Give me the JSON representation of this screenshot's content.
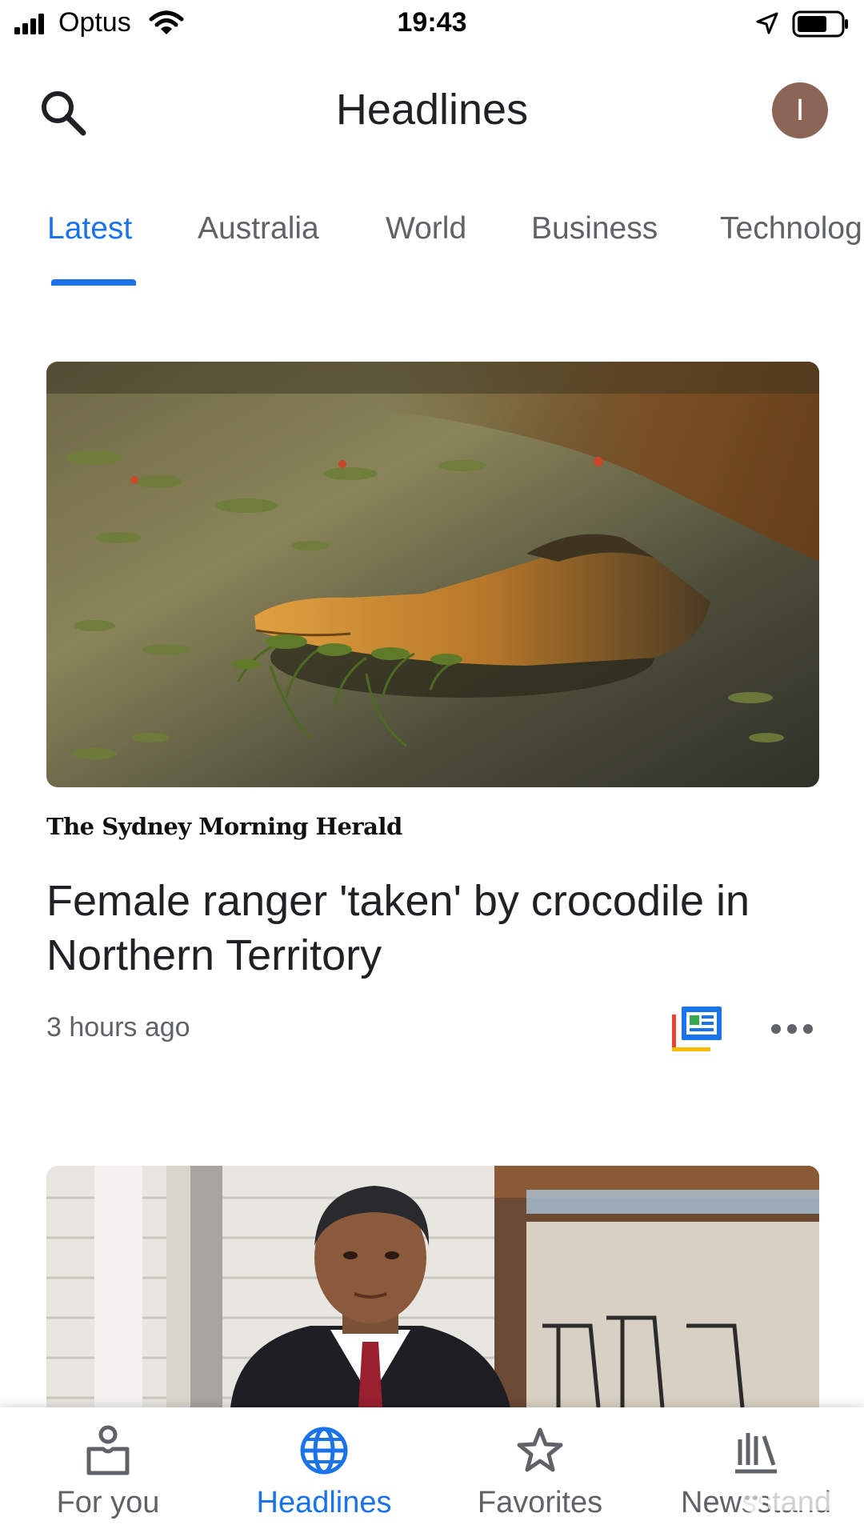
{
  "status_bar": {
    "carrier": "Optus",
    "time": "19:43"
  },
  "app_bar": {
    "title": "Headlines",
    "avatar_initial": "I"
  },
  "tabs": [
    {
      "label": "Latest",
      "active": true
    },
    {
      "label": "Australia"
    },
    {
      "label": "World"
    },
    {
      "label": "Business"
    },
    {
      "label": "Technolog"
    }
  ],
  "articles": [
    {
      "source": "The Sydney Morning Herald",
      "headline": "Female ranger 'taken' by crocodile in Northern Territory",
      "time": "3 hours ago"
    }
  ],
  "bottom_nav": [
    {
      "label": "For you",
      "icon": "for-you-icon"
    },
    {
      "label": "Headlines",
      "icon": "globe-icon",
      "active": true
    },
    {
      "label": "Favorites",
      "icon": "star-icon"
    },
    {
      "label": "Newsstand",
      "icon": "newsstand-icon"
    }
  ],
  "colors": {
    "accent": "#1a73e8",
    "avatar": "#8d6557",
    "text_primary": "#202124",
    "text_secondary": "#5f6368"
  }
}
